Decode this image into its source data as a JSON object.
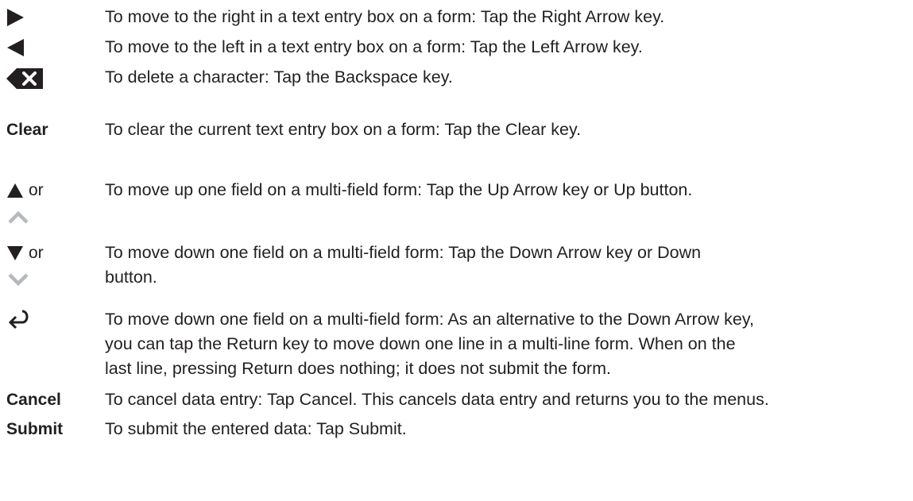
{
  "rows": [
    {
      "icon": "right-arrow-icon",
      "text": "To move to the right in a text entry box on a form: Tap the Right Arrow key."
    },
    {
      "icon": "left-arrow-icon",
      "text": "To move to the left in a text entry box on a form: Tap the Left Arrow key."
    },
    {
      "icon": "backspace-icon",
      "text": "To delete a character: Tap the Backspace key."
    },
    {
      "key_label": "Clear",
      "text": "To clear the current text entry box on a form: Tap the Clear key."
    },
    {
      "icon": "up-triangle-icon",
      "or_label": "or",
      "alt_icon": "up-chevron-icon",
      "text": "To move up one field on a multi-field form: Tap the Up Arrow key or Up button."
    },
    {
      "icon": "down-triangle-icon",
      "or_label": "or",
      "alt_icon": "down-chevron-icon",
      "text": "To move down one field on a multi-field form: Tap the Down Arrow key or Down\nbutton."
    },
    {
      "icon": "return-icon",
      "text": "To move down one field on a multi-field form: As an alternative to the Down Arrow key,\nyou can tap the Return key to move down one line in a multi-line form. When on the\nlast line, pressing Return does nothing; it does not submit the form."
    },
    {
      "key_label": "Cancel",
      "text": "To cancel data entry: Tap Cancel. This cancels data entry and returns you to the menus."
    },
    {
      "key_label": "Submit",
      "text": "To submit the entered data: Tap Submit."
    }
  ],
  "colors": {
    "text": "#231f20",
    "chevron": "#b4b9bf"
  }
}
